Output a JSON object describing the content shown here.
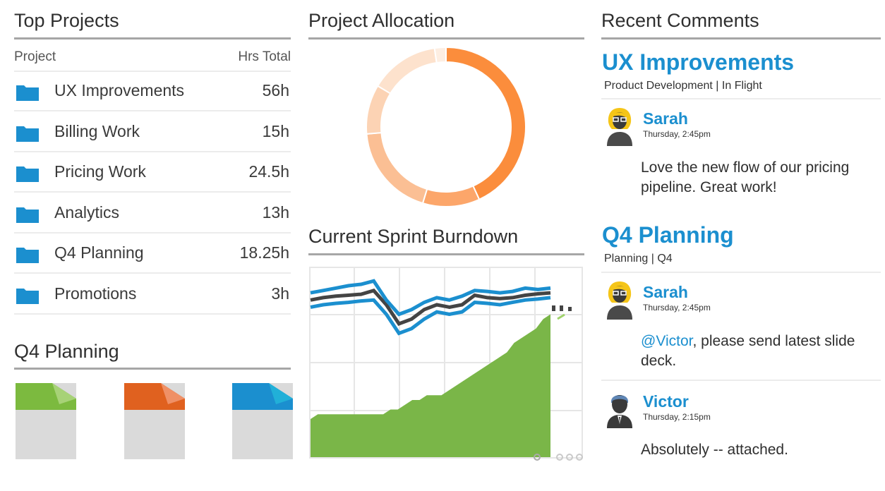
{
  "top_projects": {
    "title": "Top Projects",
    "col_project": "Project",
    "col_hours": "Hrs Total",
    "rows": [
      {
        "name": "UX Improvements",
        "hours": "56h"
      },
      {
        "name": "Billing Work",
        "hours": "15h"
      },
      {
        "name": "Pricing Work",
        "hours": "24.5h"
      },
      {
        "name": "Analytics",
        "hours": "13h"
      },
      {
        "name": "Q4 Planning",
        "hours": "18.25h"
      },
      {
        "name": "Promotions",
        "hours": "3h"
      }
    ],
    "folder_icon": "folder-icon",
    "folder_color": "#1b8fcf"
  },
  "q4_planning": {
    "title": "Q4 Planning",
    "documents": [
      {
        "icon": "document-icon",
        "color": "#7cba3f"
      },
      {
        "icon": "document-icon",
        "color": "#e0611f"
      },
      {
        "icon": "document-icon",
        "color": "#1b8fcf"
      }
    ]
  },
  "allocation": {
    "title": "Project Allocation",
    "chart_data": {
      "type": "pie",
      "donut": true,
      "values": [
        56,
        15,
        24.5,
        13,
        18.25,
        3
      ]
    }
  },
  "burndown": {
    "title": "Current Sprint Burndown",
    "chart_data": {
      "type": "line",
      "series": [
        {
          "kind": "area",
          "color": "#7ab648",
          "values": [
            8,
            9,
            9,
            9,
            9,
            9,
            9,
            9,
            9,
            9,
            9,
            10,
            10,
            11,
            12,
            12,
            13,
            13,
            13,
            14,
            15,
            16,
            17,
            18,
            19,
            20,
            21,
            22,
            24,
            25,
            26,
            27,
            29,
            30
          ]
        },
        {
          "kind": "line",
          "color": "#444444",
          "values": [
            33,
            33.5,
            33.8,
            34,
            34.2,
            35,
            32,
            28,
            29,
            31,
            32,
            31.5,
            32,
            34,
            33.5,
            33.3,
            33.5,
            34,
            34.3,
            34.5
          ]
        },
        {
          "kind": "line",
          "color": "#1b8fcf",
          "values": [
            34.5,
            35,
            35.5,
            36,
            36.3,
            37,
            33,
            30,
            31,
            32.5,
            33.5,
            33,
            33.8,
            35,
            34.8,
            34.5,
            34.8,
            35.5,
            35.2,
            35.5
          ]
        },
        {
          "kind": "line",
          "color": "#1b8fcf",
          "values": [
            31.5,
            32,
            32.3,
            32.5,
            32.8,
            33,
            30,
            26,
            27,
            29,
            30.5,
            30,
            30.5,
            32.5,
            32.3,
            32,
            32.5,
            33,
            33.2,
            33.5
          ]
        }
      ],
      "grid": true
    },
    "pager": {
      "pages": 4,
      "active": 0
    }
  },
  "comments": {
    "title": "Recent Comments",
    "groups": [
      {
        "project": "UX Improvements",
        "meta": "Product Development | In Flight",
        "entries": [
          {
            "author": "Sarah",
            "time": "Thursday, 2:45pm",
            "text": "Love the new flow of our pricing pipeline. Great work!",
            "avatar": "avatar-female-icon"
          }
        ]
      },
      {
        "project": "Q4 Planning",
        "meta": "Planning | Q4",
        "entries": [
          {
            "author": "Sarah",
            "time": "Thursday, 2:45pm",
            "mention": "@Victor",
            "text": ", please send latest slide deck.",
            "avatar": "avatar-female-icon"
          },
          {
            "author": "Victor",
            "time": "Thursday, 2:15pm",
            "text": "Absolutely -- attached.",
            "avatar": "avatar-male-icon"
          }
        ]
      }
    ]
  }
}
